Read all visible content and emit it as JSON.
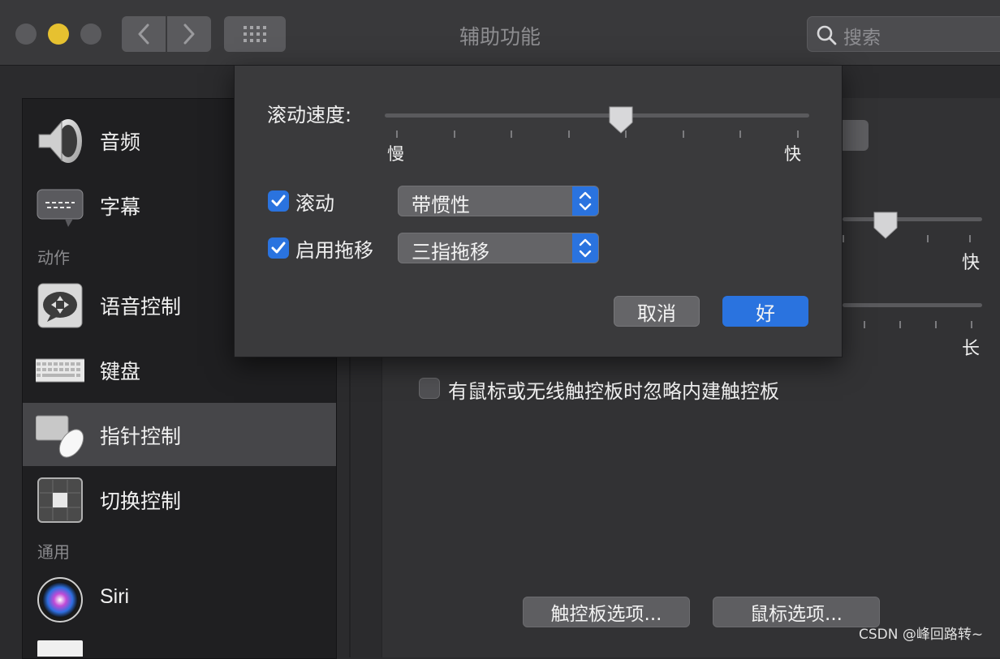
{
  "window": {
    "title": "辅助功能"
  },
  "toolbar": {
    "search_placeholder": "搜索"
  },
  "colors": {
    "close": "#5a5a5d",
    "minimize": "#e6c130",
    "zoom": "#5a5a5d",
    "accent": "#2a73df"
  },
  "sidebar": {
    "items": [
      {
        "label": "音频",
        "icon": "speaker-icon"
      },
      {
        "label": "字幕",
        "icon": "captions-icon"
      },
      {
        "label": "语音控制",
        "icon": "voice-control-icon"
      },
      {
        "label": "键盘",
        "icon": "keyboard-icon"
      },
      {
        "label": "指针控制",
        "icon": "pointer-control-icon",
        "selected": true
      },
      {
        "label": "切换控制",
        "icon": "switch-control-icon"
      },
      {
        "label": "Siri",
        "icon": "siri-icon"
      }
    ],
    "sections": {
      "motor": "动作",
      "general": "通用"
    }
  },
  "main": {
    "right_slider1_fast": "快",
    "right_slider2_long": "长",
    "ignore_trackpad_label": "有鼠标或无线触控板时忽略内建触控板",
    "trackpad_options_button": "触控板选项...",
    "mouse_options_button": "鼠标选项..."
  },
  "sheet": {
    "scroll_speed_label": "滚动速度:",
    "slider_min_label": "慢",
    "slider_max_label": "快",
    "scroll_speed_value": 0.56,
    "scroll_checkbox_label": "滚动",
    "scroll_popup_value": "带惯性",
    "drag_checkbox_label": "启用拖移",
    "drag_popup_value": "三指拖移",
    "cancel_button": "取消",
    "ok_button": "好"
  },
  "watermark": "CSDN @峰回路转~"
}
